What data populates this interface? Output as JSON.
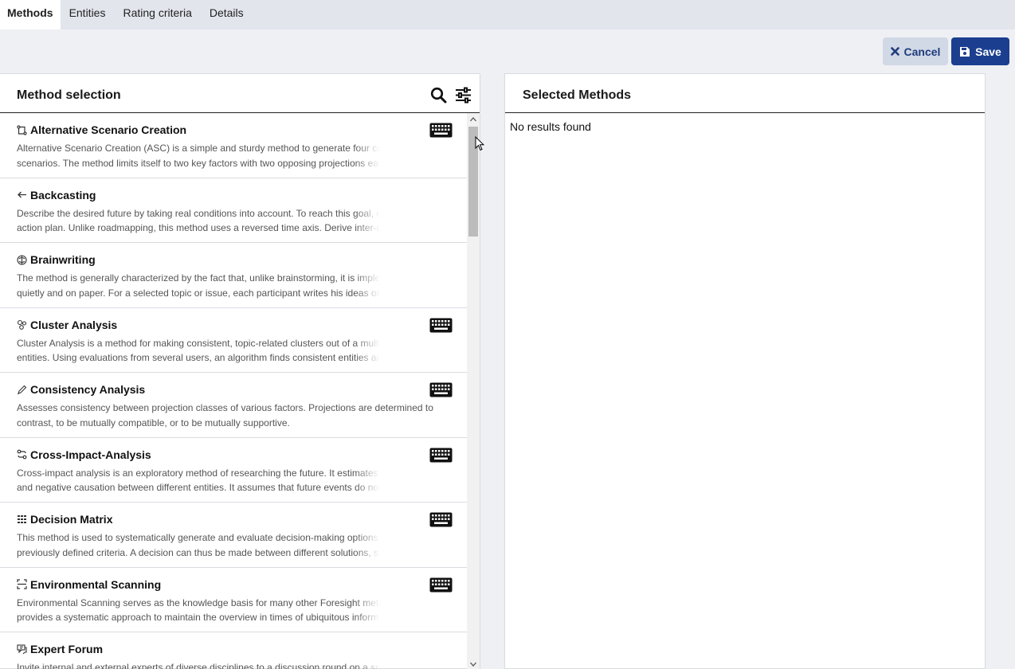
{
  "tabs": [
    {
      "label": "Methods",
      "active": true
    },
    {
      "label": "Entities"
    },
    {
      "label": "Rating criteria"
    },
    {
      "label": "Details"
    }
  ],
  "actions": {
    "cancel_label": "Cancel",
    "save_label": "Save"
  },
  "left_panel": {
    "title": "Method selection",
    "icons": [
      "search-icon",
      "filter-icon"
    ],
    "items": [
      {
        "title": "Alternative Scenario Creation",
        "icon": "scenario-icon",
        "keyboard": true,
        "desc": "Alternative Scenario Creation (ASC) is a simple and sturdy method to generate four consistent scenarios. The method limits itself to two key factors with two opposing projections each. The scenarios are"
      },
      {
        "title": "Backcasting",
        "icon": "arrow-left-icon",
        "keyboard": false,
        "desc": "Describe the desired future by taking real conditions into account. To reach this goal, develop an action plan. Unlike roadmapping, this method uses a reversed time axis. Derive inter-dependent actions from"
      },
      {
        "title": "Brainwriting",
        "icon": "brain-icon",
        "keyboard": false,
        "desc": "The method is generally characterized by the fact that, unlike brainstorming, it is implemented quietly and on paper. For a selected topic or issue, each participant writes his ideas on a sheet of paper and"
      },
      {
        "title": "Cluster Analysis",
        "icon": "cluster-icon",
        "keyboard": true,
        "desc": "Cluster Analysis is a method for making consistent, topic-related clusters out of a multitude of entities. Using evaluations from several users, an algorithm finds consistent entities and suggests the com"
      },
      {
        "title": "Consistency Analysis",
        "icon": "pen-icon",
        "keyboard": true,
        "desc": "Assesses consistency between projection classes of various factors. Projections are determined to contrast, to be mutually compatible, or to be mutually supportive."
      },
      {
        "title": "Cross-Impact-Analysis",
        "icon": "cross-impact-icon",
        "keyboard": true,
        "desc": "Cross-impact analysis is an exploratory method of researching the future. It estimates the positive and negative causation between different entities. It assumes that future events do not occur independ"
      },
      {
        "title": "Decision Matrix",
        "icon": "matrix-icon",
        "keyboard": true,
        "desc": "This method is used to systematically generate and evaluate decision-making options based on previously defined criteria. A decision can thus be made between different solutions, such as technical"
      },
      {
        "title": "Environmental Scanning",
        "icon": "scan-icon",
        "keyboard": true,
        "desc": "Environmental Scanning serves as the knowledge basis for many other Foresight methods. It provides a systematic approach to maintain the overview in times of ubiquitous information and to filter"
      },
      {
        "title": "Expert Forum",
        "icon": "forum-icon",
        "keyboard": false,
        "desc": "Invite internal and external experts of diverse disciplines to a discussion round on a specific topic. Using a"
      }
    ]
  },
  "right_panel": {
    "title": "Selected Methods",
    "empty_text": "No results found"
  }
}
